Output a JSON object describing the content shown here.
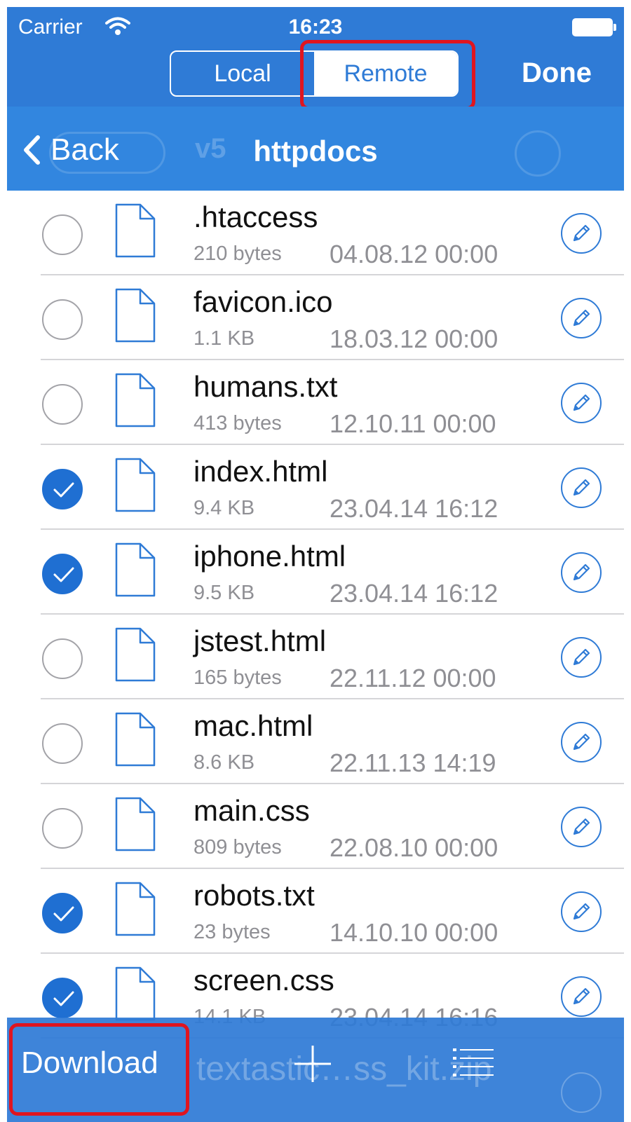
{
  "status_bar": {
    "carrier": "Carrier",
    "time": "16:23"
  },
  "header": {
    "segments": [
      {
        "label": "Local",
        "active": false
      },
      {
        "label": "Remote",
        "active": true
      }
    ],
    "done_label": "Done"
  },
  "nav": {
    "back_label": "Back",
    "background_folder": "v5",
    "title": "httpdocs"
  },
  "files": [
    {
      "name": ".htaccess",
      "size": "210 bytes",
      "date": "04.08.12 00:00",
      "selected": false
    },
    {
      "name": "favicon.ico",
      "size": "1.1 KB",
      "date": "18.03.12 00:00",
      "selected": false
    },
    {
      "name": "humans.txt",
      "size": "413 bytes",
      "date": "12.10.11 00:00",
      "selected": false
    },
    {
      "name": "index.html",
      "size": "9.4 KB",
      "date": "23.04.14 16:12",
      "selected": true
    },
    {
      "name": "iphone.html",
      "size": "9.5 KB",
      "date": "23.04.14 16:12",
      "selected": true
    },
    {
      "name": "jstest.html",
      "size": "165 bytes",
      "date": "22.11.12 00:00",
      "selected": false
    },
    {
      "name": "mac.html",
      "size": "8.6 KB",
      "date": "22.11.13 14:19",
      "selected": false
    },
    {
      "name": "main.css",
      "size": "809 bytes",
      "date": "22.08.10 00:00",
      "selected": false
    },
    {
      "name": "robots.txt",
      "size": "23 bytes",
      "date": "14.10.10 00:00",
      "selected": true
    },
    {
      "name": "screen.css",
      "size": "14.1 KB",
      "date": "23.04.14 16:16",
      "selected": true
    }
  ],
  "toolbar": {
    "download_label": "Download",
    "underlying_file": "textastic…ss_kit.zip"
  },
  "icons": {
    "file": "document-icon",
    "edit": "pencil-icon",
    "add": "plus-icon",
    "list": "list-icon"
  },
  "colors": {
    "accent": "#2f7bd6",
    "highlight": "#e0151f",
    "selected": "#1f6fd2"
  }
}
